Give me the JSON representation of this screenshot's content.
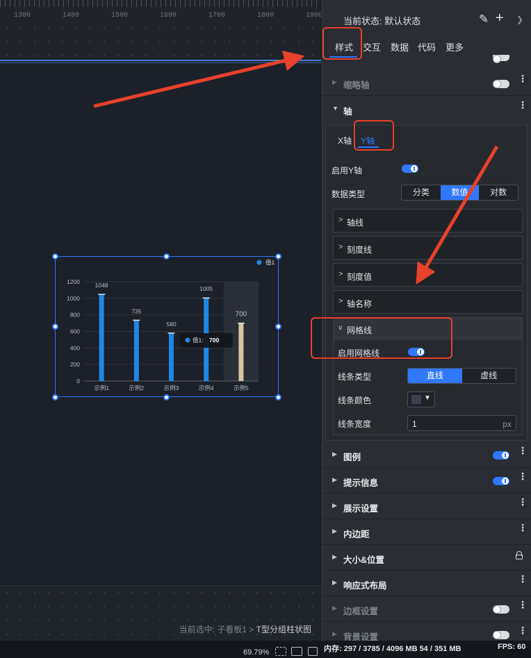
{
  "ruler": {
    "labels": [
      "1300",
      "1400",
      "1500",
      "1600",
      "1700",
      "1800",
      "1900"
    ]
  },
  "panel": {
    "state_label": "当前状态:",
    "state_value": "默认状态",
    "tabs": [
      "样式",
      "交互",
      "数据",
      "代码",
      "更多"
    ],
    "sections_top": [
      {
        "title": "缩略轴",
        "enabled": false
      }
    ],
    "axis_section": {
      "title": "轴",
      "subtabs": [
        "X轴",
        "Y轴"
      ],
      "enable_label": "启用Y轴",
      "data_type_label": "数据类型",
      "data_type_options": [
        "分类",
        "数值",
        "对数"
      ],
      "data_type_selected": "数值",
      "collapsibles": [
        "轴线",
        "刻度线",
        "刻度值",
        "轴名称"
      ],
      "grid": {
        "title": "网格线",
        "enable_label": "启用网格线",
        "line_type_label": "线条类型",
        "line_type_options": [
          "直线",
          "虚线"
        ],
        "line_type_selected": "直线",
        "line_color_label": "线条颜色",
        "line_color": "#3b3f52",
        "line_width_label": "线条宽度",
        "line_width_value": "1",
        "line_width_unit": "px"
      }
    },
    "sections_bottom": [
      {
        "title": "图例",
        "toggle": "on"
      },
      {
        "title": "提示信息",
        "toggle": "on"
      },
      {
        "title": "展示设置",
        "toggle": "none"
      },
      {
        "title": "内边距",
        "toggle": "none"
      },
      {
        "title": "大小&位置",
        "toggle": "lock"
      },
      {
        "title": "响应式布局",
        "toggle": "none"
      },
      {
        "title": "边框设置",
        "toggle": "off"
      },
      {
        "title": "背景设置",
        "toggle": "off"
      }
    ]
  },
  "canvas": {
    "selection_prefix": "当前选中: 子看板1 > ",
    "selection_name": "T型分组柱状图"
  },
  "status": {
    "zoom": "69.79%",
    "memory": "内存: 297 / 3785 / 4096 MB  54 / 351 MB",
    "fps": "FPS: 60"
  },
  "chart_data": {
    "type": "bar",
    "categories": [
      "示例1",
      "示例2",
      "示例3",
      "示例4",
      "示例5"
    ],
    "series": [
      {
        "name": "值1",
        "values": [
          1048,
          735,
          580,
          1005,
          700
        ]
      }
    ],
    "ylim": [
      0,
      1200
    ],
    "yticks": [
      0,
      200,
      400,
      600,
      800,
      1000,
      1200
    ],
    "highlight_index": 4,
    "tooltip": {
      "label": "值1:",
      "value": "700"
    },
    "colors": {
      "bar": "#1e88e5",
      "highlight": "#d6c7a1"
    },
    "legend": "top-right",
    "grid": true
  }
}
